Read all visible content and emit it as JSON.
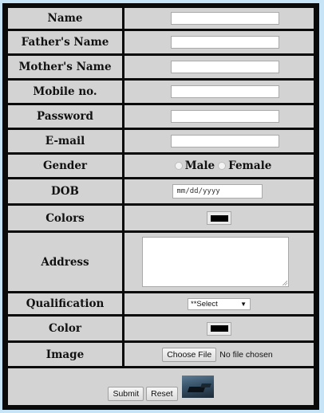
{
  "form": {
    "fields": [
      {
        "label": "Name"
      },
      {
        "label": "Father's Name"
      },
      {
        "label": "Mother's Name"
      },
      {
        "label": "Mobile no."
      },
      {
        "label": "Password"
      },
      {
        "label": "E-mail"
      }
    ],
    "gender": {
      "label": "Gender",
      "male": "Male",
      "female": "Female"
    },
    "dob": {
      "label": "DOB",
      "placeholder": "mm/dd/yyyy"
    },
    "colors": {
      "label": "Colors",
      "value": "#000000"
    },
    "address": {
      "label": "Address"
    },
    "qualification": {
      "label": "Qualification",
      "selected": "**Select"
    },
    "color": {
      "label": "Color",
      "value": "#000000"
    },
    "image": {
      "label": "Image",
      "button": "Choose File",
      "status": "No file chosen"
    },
    "actions": {
      "submit": "Submit",
      "reset": "Reset"
    }
  },
  "colors": {
    "page_bg": "#c7e4f7",
    "table_bg": "#0a0a0a",
    "cell_bg": "#d3d3d3"
  }
}
